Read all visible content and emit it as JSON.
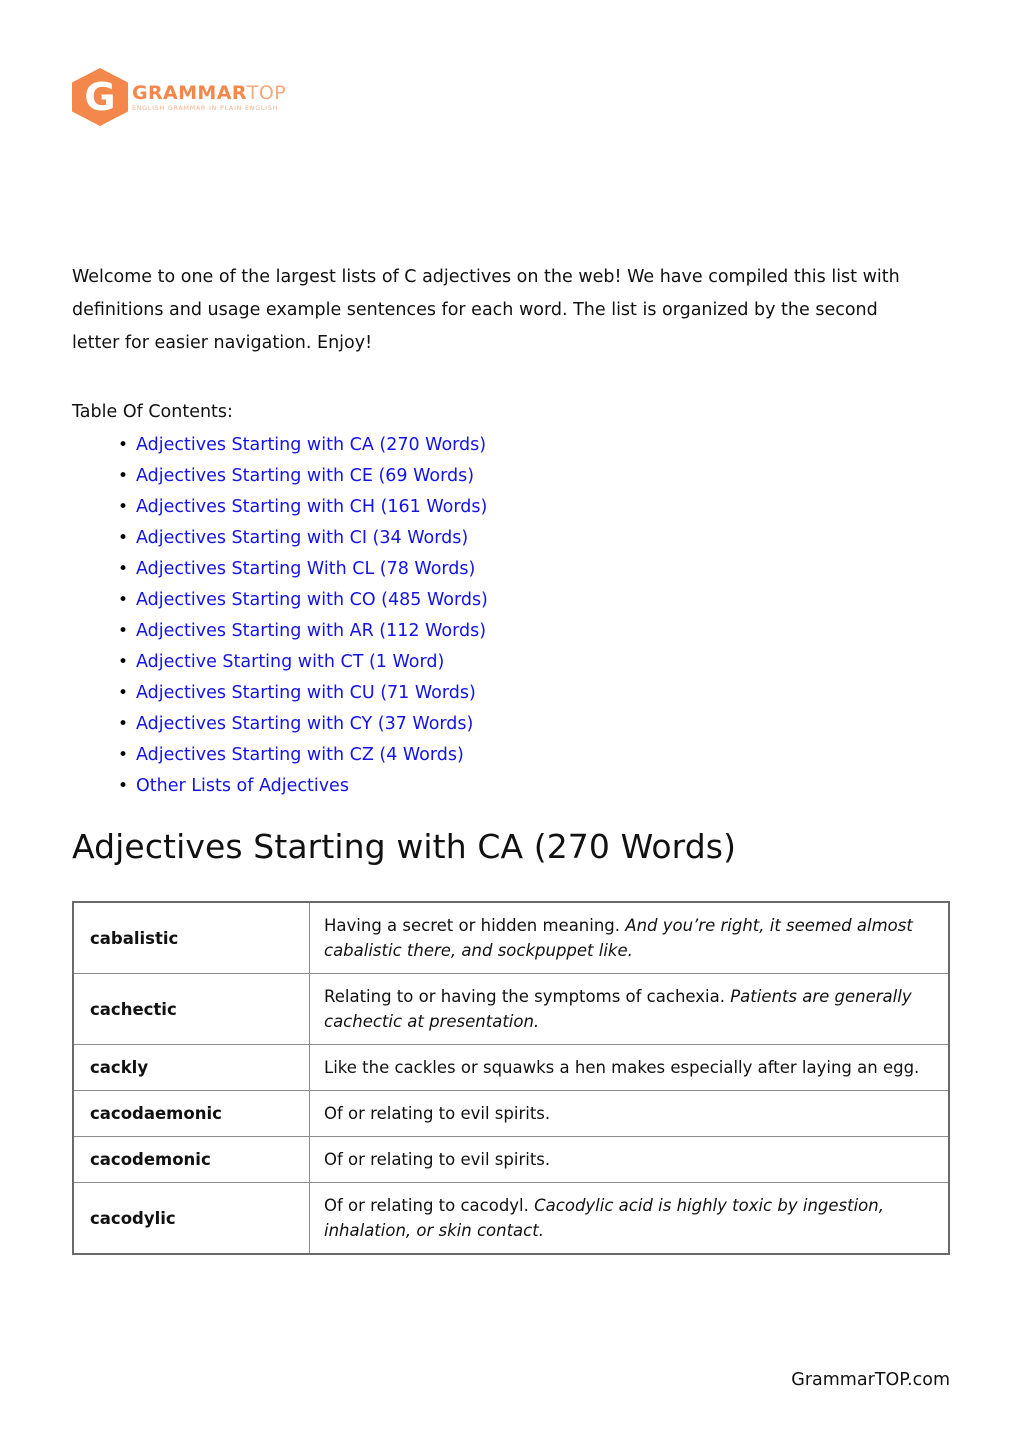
{
  "brand": {
    "hex_letter": "G",
    "wordmark_strong": "GRAMMAR",
    "wordmark_light": "TOP",
    "tagline": "ENGLISH GRAMMAR IN PLAIN ENGLISH",
    "accent_color": "#F4874B",
    "accent_light_color": "#F9A878"
  },
  "intro": {
    "paragraph": "Welcome to one of the largest lists of C adjectives on the web! We have compiled this list with definitions and usage example sentences for each word. The list is organized by the second letter for easier navigation. Enjoy!"
  },
  "toc": {
    "label": "Table Of Contents:",
    "link_color": "#1414E6",
    "items": [
      {
        "label": "Adjectives Starting with CA (270 Words)"
      },
      {
        "label": "Adjectives Starting with CE (69 Words)"
      },
      {
        "label": "Adjectives Starting with CH (161 Words)"
      },
      {
        "label": "Adjectives Starting with CI (34 Words)"
      },
      {
        "label": "Adjectives Starting With CL (78 Words)"
      },
      {
        "label": "Adjectives Starting with CO (485 Words)"
      },
      {
        "label": "Adjectives Starting with AR (112 Words)"
      },
      {
        "label": "Adjective Starting with CT (1 Word)"
      },
      {
        "label": "Adjectives Starting with CU (71 Words)"
      },
      {
        "label": "Adjectives Starting with CY (37 Words)"
      },
      {
        "label": "Adjectives Starting with CZ (4 Words)"
      },
      {
        "label": "Other Lists of Adjectives"
      }
    ]
  },
  "section": {
    "heading": "Adjectives Starting with CA (270 Words)"
  },
  "table": {
    "rows": [
      {
        "word": "cabalistic",
        "definition": "Having a secret or hidden meaning.",
        "example": "And you’re right, it seemed almost cabalistic there, and sockpuppet like."
      },
      {
        "word": "cachectic",
        "definition": "Relating to or having the symptoms of cachexia.",
        "example": "Patients are generally cachectic at presentation."
      },
      {
        "word": "cackly",
        "definition": "Like the cackles or squawks a hen makes especially after laying an egg.",
        "example": ""
      },
      {
        "word": "cacodaemonic",
        "definition": "Of or relating to evil spirits.",
        "example": ""
      },
      {
        "word": "cacodemonic",
        "definition": "Of or relating to evil spirits.",
        "example": ""
      },
      {
        "word": "cacodylic",
        "definition": "Of or relating to cacodyl.",
        "example": "Cacodylic acid is highly toxic by ingestion, inhalation, or skin contact."
      }
    ]
  },
  "footer": {
    "site": "GrammarTOP.com"
  }
}
